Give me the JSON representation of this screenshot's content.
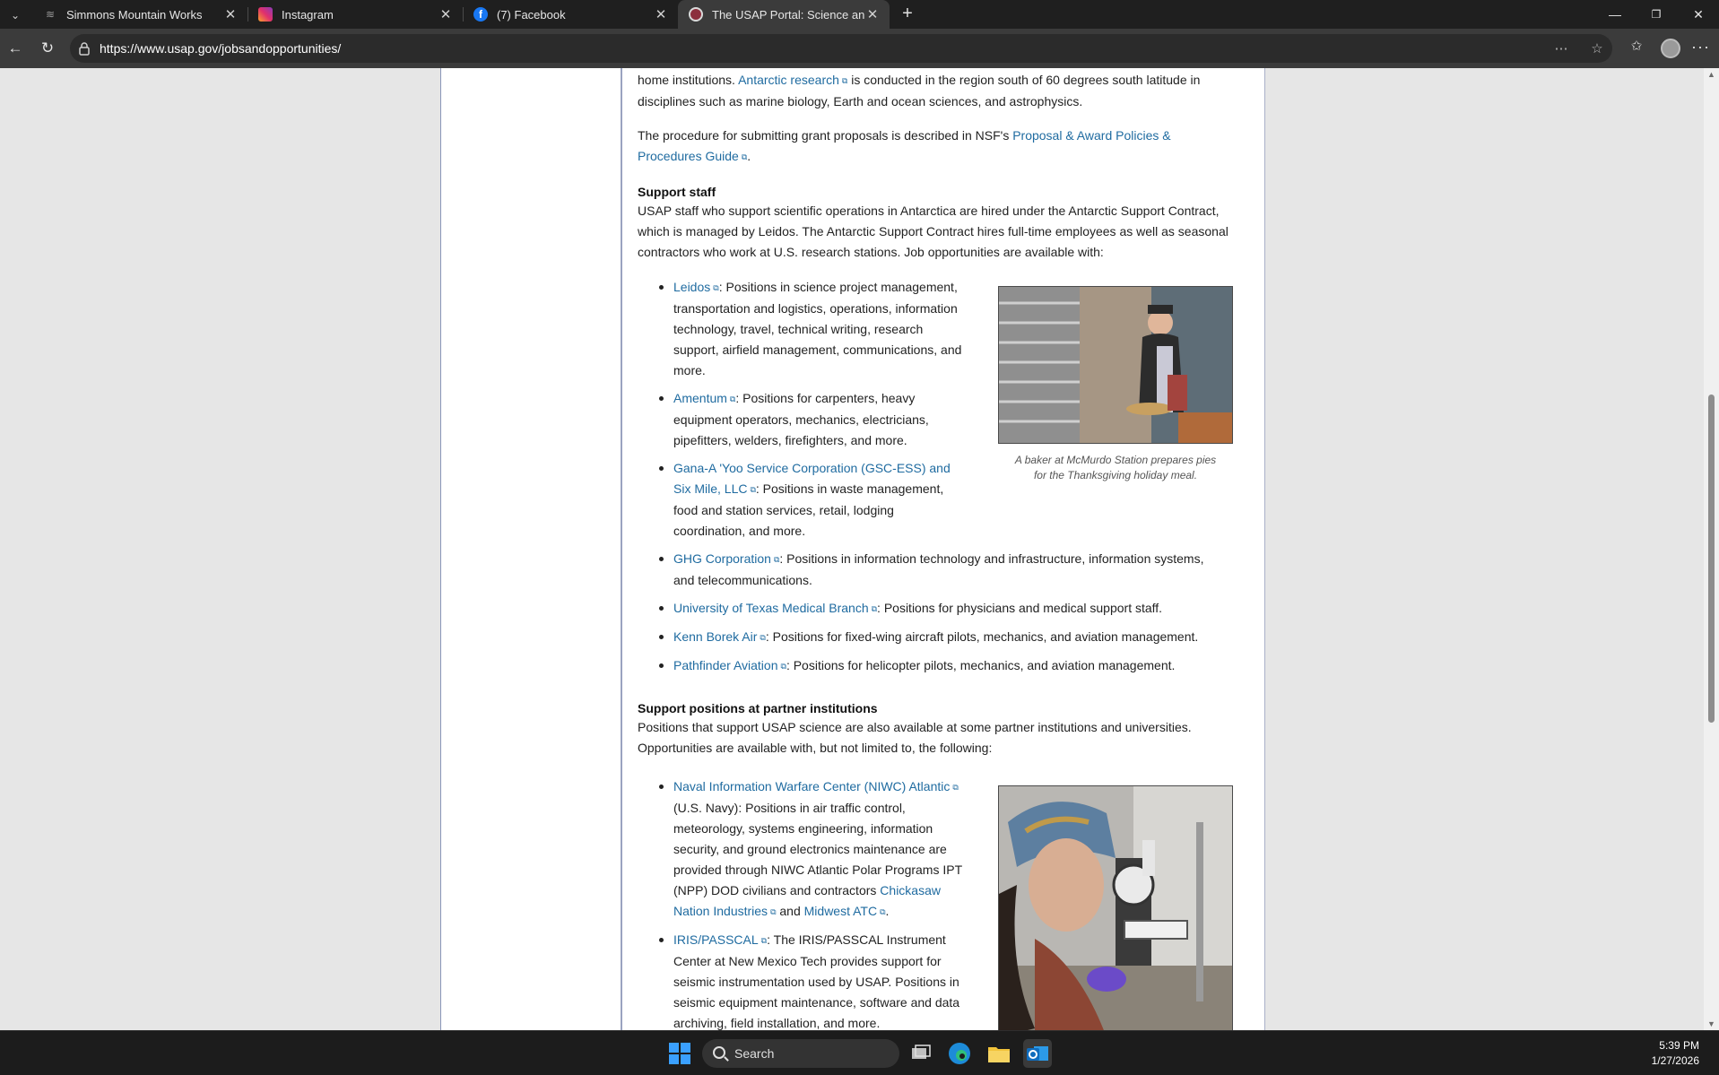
{
  "browser": {
    "tabs": [
      {
        "title": "Simmons Mountain Works",
        "favicon": "simmons-icon",
        "active": false
      },
      {
        "title": "Instagram",
        "favicon": "instagram-icon",
        "active": false
      },
      {
        "title": "(7) Facebook",
        "favicon": "facebook-icon",
        "active": false
      },
      {
        "title": "The USAP Portal: Science and Sup",
        "favicon": "usap-icon",
        "active": true
      }
    ],
    "url": "https://www.usap.gov/jobsandopportunities/",
    "window_controls": {
      "minimize": "—",
      "restore": "❐",
      "close": "✕"
    },
    "new_tab": "+",
    "more": "···"
  },
  "article": {
    "p1": {
      "pre": "home institutions.",
      "link": "Antarctic research",
      "post_line1": "is conducted in the region south of 60 degrees south latitude in",
      "line2": "disciplines such as marine biology, Earth and ocean sciences, and astrophysics."
    },
    "p2": {
      "text": "The procedure for submitting grant proposals is described in NSF's",
      "link_line1": "Proposal & Award Policies &",
      "link_line2": "Procedures Guide",
      "end": "."
    },
    "support_staff": {
      "heading": "Support staff",
      "line1": "USAP staff who support scientific operations in Antarctica are hired under the Antarctic Support Contract,",
      "line2": "which is managed by Leidos. The Antarctic Support Contract hires full-time employees as well as seasonal",
      "line3": "contractors who work at U.S. research stations. Job opportunities are available with:",
      "items": [
        {
          "link": "Leidos",
          "lines": [
            ": Positions in science project management,",
            "transportation and logistics, operations, information",
            "technology, travel, technical writing, research",
            "support, airfield management, communications, and",
            "more."
          ]
        },
        {
          "link": "Amentum",
          "lines": [
            ": Positions for carpenters, heavy",
            "equipment operators, mechanics, electricians,",
            "pipefitters, welders, firefighters, and more."
          ]
        },
        {
          "link_line1": "Gana-A 'Yoo Service Corporation (GSC-ESS) and",
          "link_line2": "Six Mile, LLC",
          "lines": [
            ": Positions in waste management,",
            "food and station services, retail, lodging",
            "coordination, and more."
          ]
        },
        {
          "link": "GHG Corporation",
          "lines": [
            ": Positions in information technology and infrastructure, information systems,",
            "and telecommunications."
          ]
        },
        {
          "link": "University of Texas Medical Branch",
          "lines": [
            ": Positions for physicians and medical support staff."
          ]
        },
        {
          "link": "Kenn Borek Air",
          "lines": [
            ": Positions for fixed-wing aircraft pilots, mechanics, and aviation management."
          ]
        },
        {
          "link": "Pathfinder Aviation",
          "lines": [
            ": Positions for helicopter pilots, mechanics, and aviation management."
          ]
        }
      ],
      "figure_caption_line1": "A baker at McMurdo Station prepares pies",
      "figure_caption_line2": "for the Thanksgiving holiday meal."
    },
    "partner": {
      "heading": "Support positions at partner institutions",
      "line1": "Positions that support USAP science are also available at some partner institutions and universities.",
      "line2": "Opportunities are available with, but not limited to, the following:",
      "items": [
        {
          "link": "Naval Information Warfare Center (NIWC) Atlantic",
          "lines": [
            "(U.S. Navy): Positions in air traffic control,",
            "meteorology, systems engineering, information",
            "security, and ground electronics maintenance are",
            "provided through NIWC Atlantic Polar Programs IPT"
          ],
          "line_pre_link": "(NPP) DOD civilians and contractors",
          "link2_line1": "Chickasaw",
          "link2_line2": "Nation Industries",
          "and": "and",
          "link3": "Midwest ATC",
          "end": "."
        },
        {
          "link": "IRIS/PASSCAL",
          "lines": [
            ": The IRIS/PASSCAL Instrument",
            "Center at New Mexico Tech provides support for",
            "seismic instrumentation used by USAP. Positions in",
            "seismic equipment maintenance, software and data",
            "archiving, field installation, and more."
          ]
        }
      ]
    }
  },
  "taskbar": {
    "search_label": "Search",
    "time": "5:39 PM",
    "date": "1/27/2026",
    "apps": [
      "windows-start-icon",
      "task-view-icon",
      "edge-icon",
      "file-explorer-icon",
      "outlook-icon"
    ]
  },
  "colors": {
    "link": "#1f6ba0",
    "text": "#222222",
    "page_bg": "#e6e6e6"
  }
}
